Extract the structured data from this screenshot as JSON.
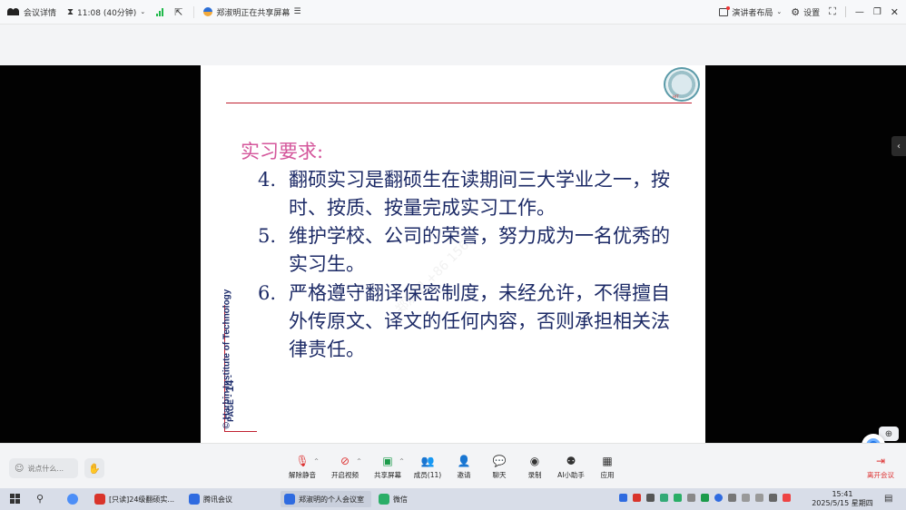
{
  "topbar": {
    "meeting_details": "会议详情",
    "timer": "11:08 (40分钟)",
    "sharing_status": "郑淑明正在共享屏幕",
    "presenter_layout": "演讲者布局",
    "settings": "设置"
  },
  "slide": {
    "heading": "实习要求:",
    "items": [
      {
        "num": "4.",
        "text": "翻硕实习是翻硕生在读期间三大学业之一，按时、按质、按量完成实习工作。"
      },
      {
        "num": "5.",
        "text": "维护学校、公司的荣誉，努力成为一名优秀的实习生。"
      },
      {
        "num": "6.",
        "text": "严格遵守翻译保密制度，未经允许，不得擅自外传原文、译文的任何内容，否则承担相关法律责任。"
      }
    ],
    "side_text": "© Harbin Institute of Technology",
    "page_label": "PAGE",
    "page_number": "14",
    "emblem_text": "HIT",
    "watermark": "郑淑明 +86 1565"
  },
  "toolbar": {
    "chat_placeholder": "说点什么...",
    "buttons": [
      {
        "label": "解除静音",
        "icon": "mic-muted-icon"
      },
      {
        "label": "开启视频",
        "icon": "camera-off-icon"
      },
      {
        "label": "共享屏幕",
        "icon": "share-screen-icon"
      },
      {
        "label": "成员(11)",
        "icon": "members-icon"
      },
      {
        "label": "邀请",
        "icon": "invite-icon"
      },
      {
        "label": "聊天",
        "icon": "chat-icon"
      },
      {
        "label": "录制",
        "icon": "record-icon"
      },
      {
        "label": "AI小助手",
        "icon": "ai-assistant-icon"
      },
      {
        "label": "应用",
        "icon": "apps-icon"
      }
    ],
    "leave": "离开会议"
  },
  "taskbar": {
    "apps": [
      {
        "label": "[只读]24级翻硕实...",
        "color": "#d9342b"
      },
      {
        "label": "腾讯会议",
        "color": "#2f6be0"
      },
      {
        "label": "郑淑明的个人会议室",
        "color": "#2f6be0"
      },
      {
        "label": "微信",
        "color": "#2aae67"
      }
    ],
    "time": "15:41",
    "date": "2025/5/15 星期四"
  }
}
